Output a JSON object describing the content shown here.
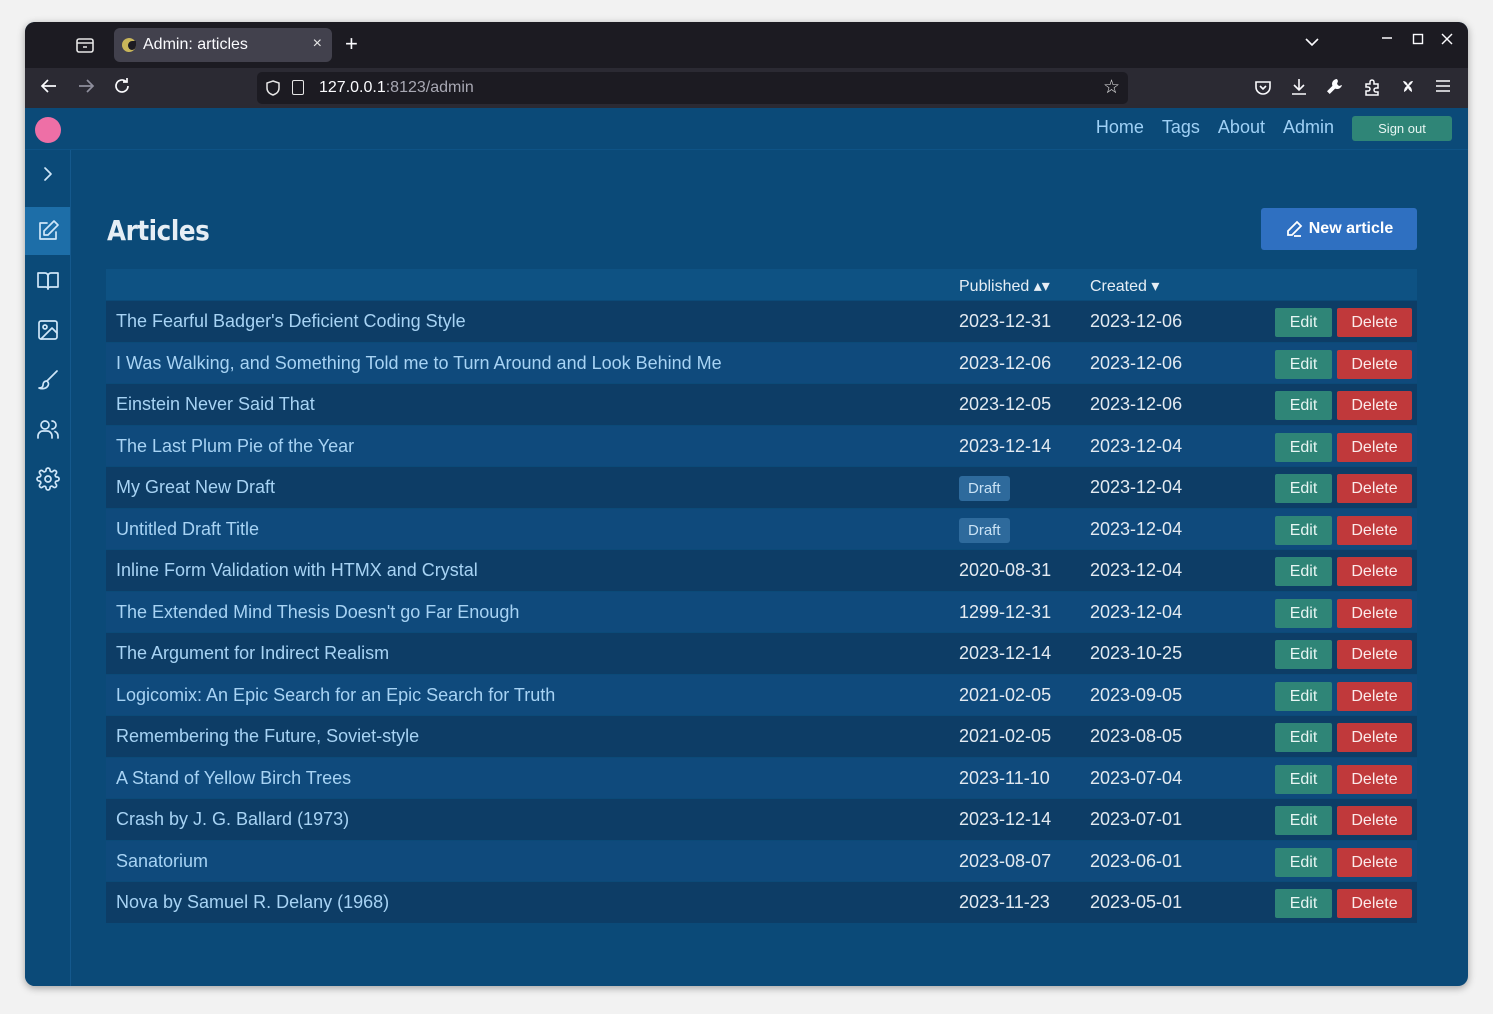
{
  "browser": {
    "tab_title": "Admin: articles",
    "tab_close": "×",
    "new_tab": "+",
    "url_host": "127.0.0.1",
    "url_rest": ":8123/admin"
  },
  "header": {
    "nav": [
      "Home",
      "Tags",
      "About",
      "Admin"
    ],
    "sign_out": "Sign out"
  },
  "sidebar": {
    "items": [
      "expand-icon",
      "edit-icon",
      "book-icon",
      "image-icon",
      "brush-icon",
      "users-icon",
      "gear-icon"
    ]
  },
  "main": {
    "title": "Articles",
    "new_article": "New article",
    "columns": {
      "published": "Published ▴▾",
      "created": "Created ▾"
    },
    "edit_label": "Edit",
    "delete_label": "Delete",
    "rows": [
      {
        "title": "The Fearful Badger's Deficient Coding Style",
        "published": "2023-12-31",
        "created": "2023-12-06"
      },
      {
        "title": "I Was Walking, and Something Told me to Turn Around and Look Behind Me",
        "published": "2023-12-06",
        "created": "2023-12-06"
      },
      {
        "title": "Einstein Never Said That",
        "published": "2023-12-05",
        "created": "2023-12-06"
      },
      {
        "title": "The Last Plum Pie of the Year",
        "published": "2023-12-14",
        "created": "2023-12-04"
      },
      {
        "title": "My Great New Draft",
        "published": "Draft",
        "created": "2023-12-04",
        "draft": true
      },
      {
        "title": "Untitled Draft Title",
        "published": "Draft",
        "created": "2023-12-04",
        "draft": true
      },
      {
        "title": "Inline Form Validation with HTMX and Crystal",
        "published": "2020-08-31",
        "created": "2023-12-04"
      },
      {
        "title": "The Extended Mind Thesis Doesn't go Far Enough",
        "published": "1299-12-31",
        "created": "2023-12-04"
      },
      {
        "title": "The Argument for Indirect Realism",
        "published": "2023-12-14",
        "created": "2023-10-25"
      },
      {
        "title": "Logicomix: An Epic Search for an Epic Search for Truth",
        "published": "2021-02-05",
        "created": "2023-09-05"
      },
      {
        "title": "Remembering the Future, Soviet-style",
        "published": "2021-02-05",
        "created": "2023-08-05"
      },
      {
        "title": "A Stand of Yellow Birch Trees",
        "published": "2023-11-10",
        "created": "2023-07-04"
      },
      {
        "title": "Crash by J. G. Ballard (1973)",
        "published": "2023-12-14",
        "created": "2023-07-01"
      },
      {
        "title": "Sanatorium",
        "published": "2023-08-07",
        "created": "2023-06-01"
      },
      {
        "title": "Nova by Samuel R. Delany (1968)",
        "published": "2023-11-23",
        "created": "2023-05-01"
      }
    ]
  },
  "colors": {
    "page_bg": "#0b4a78",
    "accent": "#2f70c1",
    "edit": "#2f8577",
    "delete": "#c0393b",
    "logo": "#ee6fa6"
  }
}
